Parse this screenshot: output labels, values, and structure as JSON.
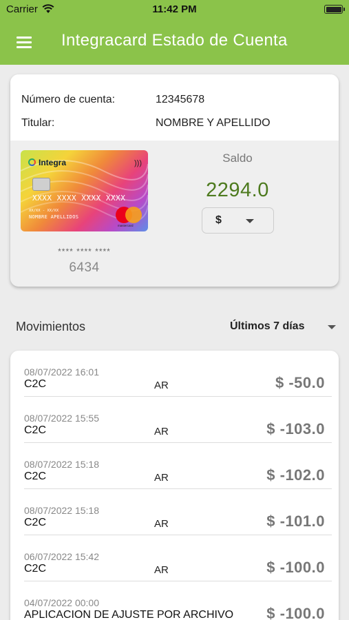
{
  "status_bar": {
    "carrier": "Carrier",
    "time": "11:42 PM"
  },
  "app_bar": {
    "title": "Integracard Estado de Cuenta"
  },
  "account": {
    "number_label": "Número de cuenta:",
    "number_value": "12345678",
    "holder_label": "Titular:",
    "holder_value": "NOMBRE Y APELLIDO",
    "card": {
      "brand": "Integra",
      "number": "XXXX XXXX XXXX XXXX",
      "expiry": "XX/XX - XX/XX",
      "name": "NOMBRE APELLIDOS",
      "network": "mastercard",
      "masked": "**** **** ****",
      "last4": "6434"
    },
    "balance_label": "Saldo",
    "balance_value": "2294.0",
    "currency": "$"
  },
  "movements": {
    "title": "Movimientos",
    "range": "Últimos 7 días",
    "rows": [
      {
        "date": "08/07/2022 16:01",
        "desc": "C2C",
        "country": "AR",
        "amount": "$ -50.0"
      },
      {
        "date": "08/07/2022 15:55",
        "desc": "C2C",
        "country": "AR",
        "amount": "$ -103.0"
      },
      {
        "date": "08/07/2022 15:18",
        "desc": "C2C",
        "country": "AR",
        "amount": "$ -102.0"
      },
      {
        "date": "08/07/2022 15:18",
        "desc": "C2C",
        "country": "AR",
        "amount": "$ -101.0"
      },
      {
        "date": "06/07/2022 15:42",
        "desc": "C2C",
        "country": "AR",
        "amount": "$ -100.0"
      },
      {
        "date": "04/07/2022 00:00",
        "desc": "APLICACION DE AJUSTE POR ARCHIVO",
        "country": "",
        "amount": "$ -100.0"
      }
    ]
  },
  "colors": {
    "accent": "#8bc34a",
    "balance": "#4d7a1e"
  }
}
